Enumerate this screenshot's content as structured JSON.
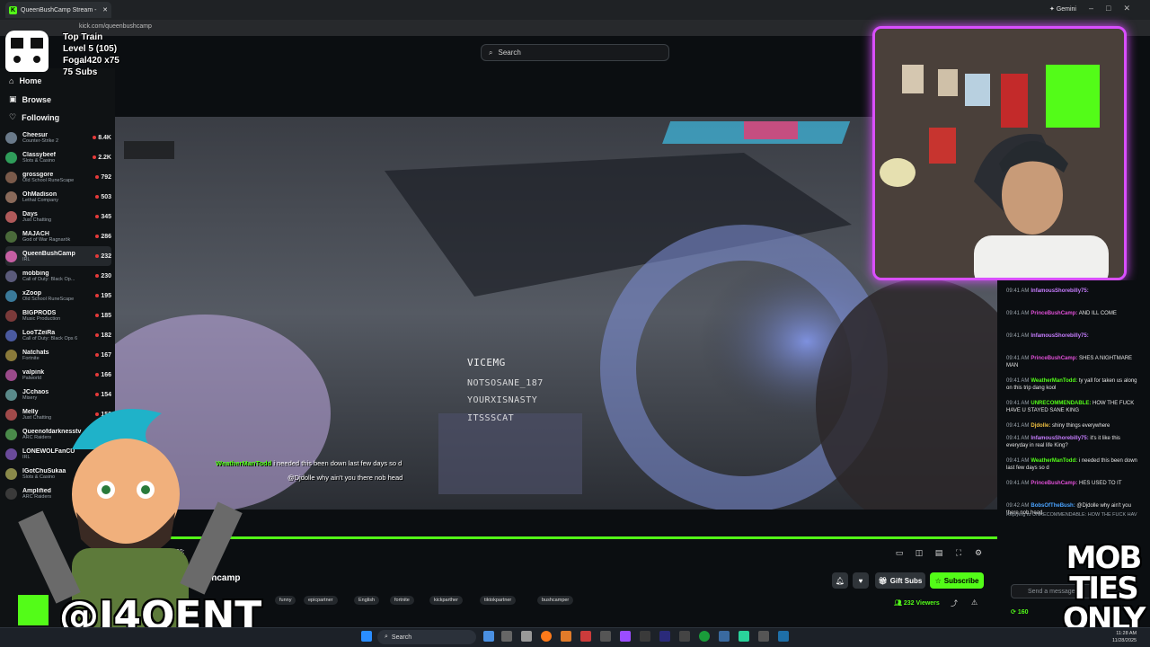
{
  "browser": {
    "tab_title": "QueenBushCamp Stream -",
    "url": "kick.com/queenbushcamp",
    "gemini_label": "Gemini"
  },
  "header": {
    "search_placeholder": "Search"
  },
  "overlay": {
    "train_title": "Top Train",
    "train_level": "Level 5  (105)",
    "train_top": "Fogal420 x75",
    "train_subs": "75 Subs",
    "handle": "@J4OENT",
    "mobties": "MOB TIES ONLY"
  },
  "sidebar": {
    "nav": [
      {
        "label": "Home",
        "icon": "home-icon"
      },
      {
        "label": "Browse",
        "icon": "browse-icon"
      },
      {
        "label": "Following",
        "icon": "heart-icon"
      }
    ],
    "channels": [
      {
        "name": "Cheesur",
        "game": "Counter-Strike 2",
        "viewers": "8.4K"
      },
      {
        "name": "Classybeef",
        "game": "Slots & Casino",
        "viewers": "2.2K"
      },
      {
        "name": "grossgore",
        "game": "Old School RuneScape",
        "viewers": "792"
      },
      {
        "name": "OhMadison",
        "game": "Lethal Company",
        "viewers": "503"
      },
      {
        "name": "Days",
        "game": "Just Chatting",
        "viewers": "345"
      },
      {
        "name": "MAJACH",
        "game": "God of War Ragnarök",
        "viewers": "286"
      },
      {
        "name": "QueenBushCamp",
        "game": "IRL",
        "viewers": "232"
      },
      {
        "name": "mobbing",
        "game": "Call of Duty: Black Op...",
        "viewers": "230"
      },
      {
        "name": "xZoop",
        "game": "Old School RuneScape",
        "viewers": "195"
      },
      {
        "name": "BIGPRODS",
        "game": "Music Production",
        "viewers": "185"
      },
      {
        "name": "LooTZeiRa",
        "game": "Call of Duty: Black Ops 6",
        "viewers": "182"
      },
      {
        "name": "Natchats",
        "game": "Fortnite",
        "viewers": "167"
      },
      {
        "name": "valpink",
        "game": "Palworld",
        "viewers": "166"
      },
      {
        "name": "JCchaos",
        "game": "Misery",
        "viewers": "154"
      },
      {
        "name": "Melly",
        "game": "Just Chatting",
        "viewers": "152"
      },
      {
        "name": "Queenofdarknesstv",
        "game": "ARC Raiders",
        "viewers": ""
      },
      {
        "name": "LONEWOLFanCU",
        "game": "IRL",
        "viewers": ""
      },
      {
        "name": "IGotChuSukaa",
        "game": "Slots & Casino",
        "viewers": ""
      },
      {
        "name": "Amplified",
        "game": "ARC Raiders",
        "viewers": ""
      }
    ]
  },
  "video": {
    "scoreboard": [
      "VICEMG",
      "NOTSOSANE_187",
      "YOURXISNASTY",
      "ITSSSCAT"
    ],
    "chat_line_1_user": "WeatherManTodd",
    "chat_line_1_text": "i needed this been down last few days so d",
    "chat_line_2_text": "@Djdolle why ain't you there nob head",
    "timecode": "00:20:",
    "progress": 1.0
  },
  "stream_info": {
    "streamer": "queenbushcamp",
    "tags": [
      "funny",
      "epicpartner",
      "English",
      "fortnite",
      "kickparther",
      "tiktokpartner",
      "bushcamper"
    ],
    "gift_label": "Gift Subs",
    "subscribe_label": "Subscribe",
    "viewers": "232 Viewers"
  },
  "chat": {
    "messages": [
      {
        "time": "09:41 AM",
        "user": "InfamousShorebilly75:",
        "text": "",
        "color": "#c77dff"
      },
      {
        "time": "09:41 AM",
        "user": "PrinceBushCamp:",
        "text": "AND ILL COME",
        "color": "#e04fd7"
      },
      {
        "time": "09:41 AM",
        "user": "InfamousShorebilly75:",
        "text": "",
        "color": "#c77dff"
      },
      {
        "time": "09:41 AM",
        "user": "PrinceBushCamp:",
        "text": "SHES A NIGHTMARE MAN",
        "color": "#e04fd7"
      },
      {
        "time": "09:41 AM",
        "user": "WeatherManTodd:",
        "text": "ty yall for taken us along on this trip dang kool",
        "color": "#53fc18"
      },
      {
        "time": "09:41 AM",
        "user": "UNRECOMMENDABLE:",
        "text": "HOW THE FUCK HAVE U STAYED SANE KING",
        "color": "#53fc18"
      },
      {
        "time": "09:41 AM",
        "user": "Djdolle:",
        "text": "shiny things everywhere",
        "color": "#f0c040"
      },
      {
        "time": "09:41 AM",
        "user": "InfamousShorebilly75:",
        "text": "it's it like this everyday in real life King?",
        "color": "#c77dff"
      },
      {
        "time": "09:41 AM",
        "user": "WeatherManTodd:",
        "text": "i needed this been down last few days so d",
        "color": "#53fc18"
      },
      {
        "time": "09:41 AM",
        "user": "PrinceBushCamp:",
        "text": "HES USED TO IT",
        "color": "#e04fd7"
      },
      {
        "time": "09:42 AM",
        "user": "BobsOfTheBush:",
        "text": "@Djdolle why ain't you there nob head",
        "color": "#4aa3ff"
      }
    ],
    "reply_note": "Replying to UNRECOMMENDABLE: HOW THE FUCK HAV",
    "input_placeholder": "Send a message",
    "points": "160"
  },
  "taskbar": {
    "search_label": "Search",
    "time": "11:28 AM",
    "date": "11/28/2025"
  },
  "colors": {
    "accent": "#53fc18",
    "cam_border": "#d94fff"
  }
}
